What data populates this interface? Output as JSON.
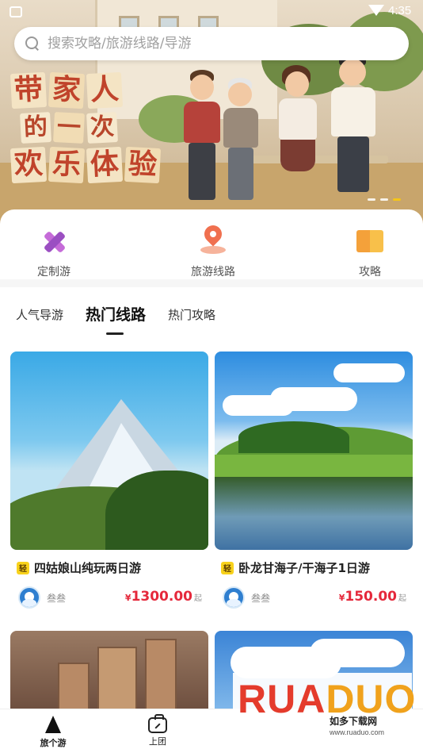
{
  "status_bar": {
    "time": "4:35"
  },
  "search": {
    "placeholder": "搜索攻略/旅游线路/导游"
  },
  "banner": {
    "line1": [
      "带",
      "家",
      "人"
    ],
    "line2": [
      "的",
      "一",
      "次"
    ],
    "line3": [
      "欢",
      "乐",
      "体",
      "验"
    ],
    "slide_count": 3,
    "active_slide": 3
  },
  "quick_nav": [
    {
      "label": "定制游",
      "icon": "custom-trip-icon"
    },
    {
      "label": "旅游线路",
      "icon": "route-pin-icon"
    },
    {
      "label": "攻略",
      "icon": "guide-book-icon"
    }
  ],
  "tabs": [
    {
      "label": "人气导游",
      "active": false
    },
    {
      "label": "热门线路",
      "active": true
    },
    {
      "label": "热门攻略",
      "active": false
    }
  ],
  "cards": [
    {
      "badge": "轻",
      "title": "四姑娘山纯玩两日游",
      "author": "叁叁",
      "currency": "¥",
      "price": "1300.00",
      "unit": "起"
    },
    {
      "badge": "轻",
      "title": "卧龙甘海子/干海子1日游",
      "author": "叁叁",
      "currency": "¥",
      "price": "150.00",
      "unit": "起"
    }
  ],
  "bottom_nav": [
    {
      "label": "旅个游",
      "icon": "mountain-icon",
      "active": true
    },
    {
      "label": "上团",
      "icon": "bag-icon",
      "active": false
    }
  ],
  "watermark": {
    "brand": "RUADUO",
    "brand_a": "RUA",
    "brand_b": "DUO",
    "tagline": "如多下载网",
    "url": "www.ruaduo.com"
  },
  "colors": {
    "price": "#e5283b",
    "badge": "#f8d21c",
    "dot_active": "#f5c518",
    "banner_text": "#c0432b"
  }
}
